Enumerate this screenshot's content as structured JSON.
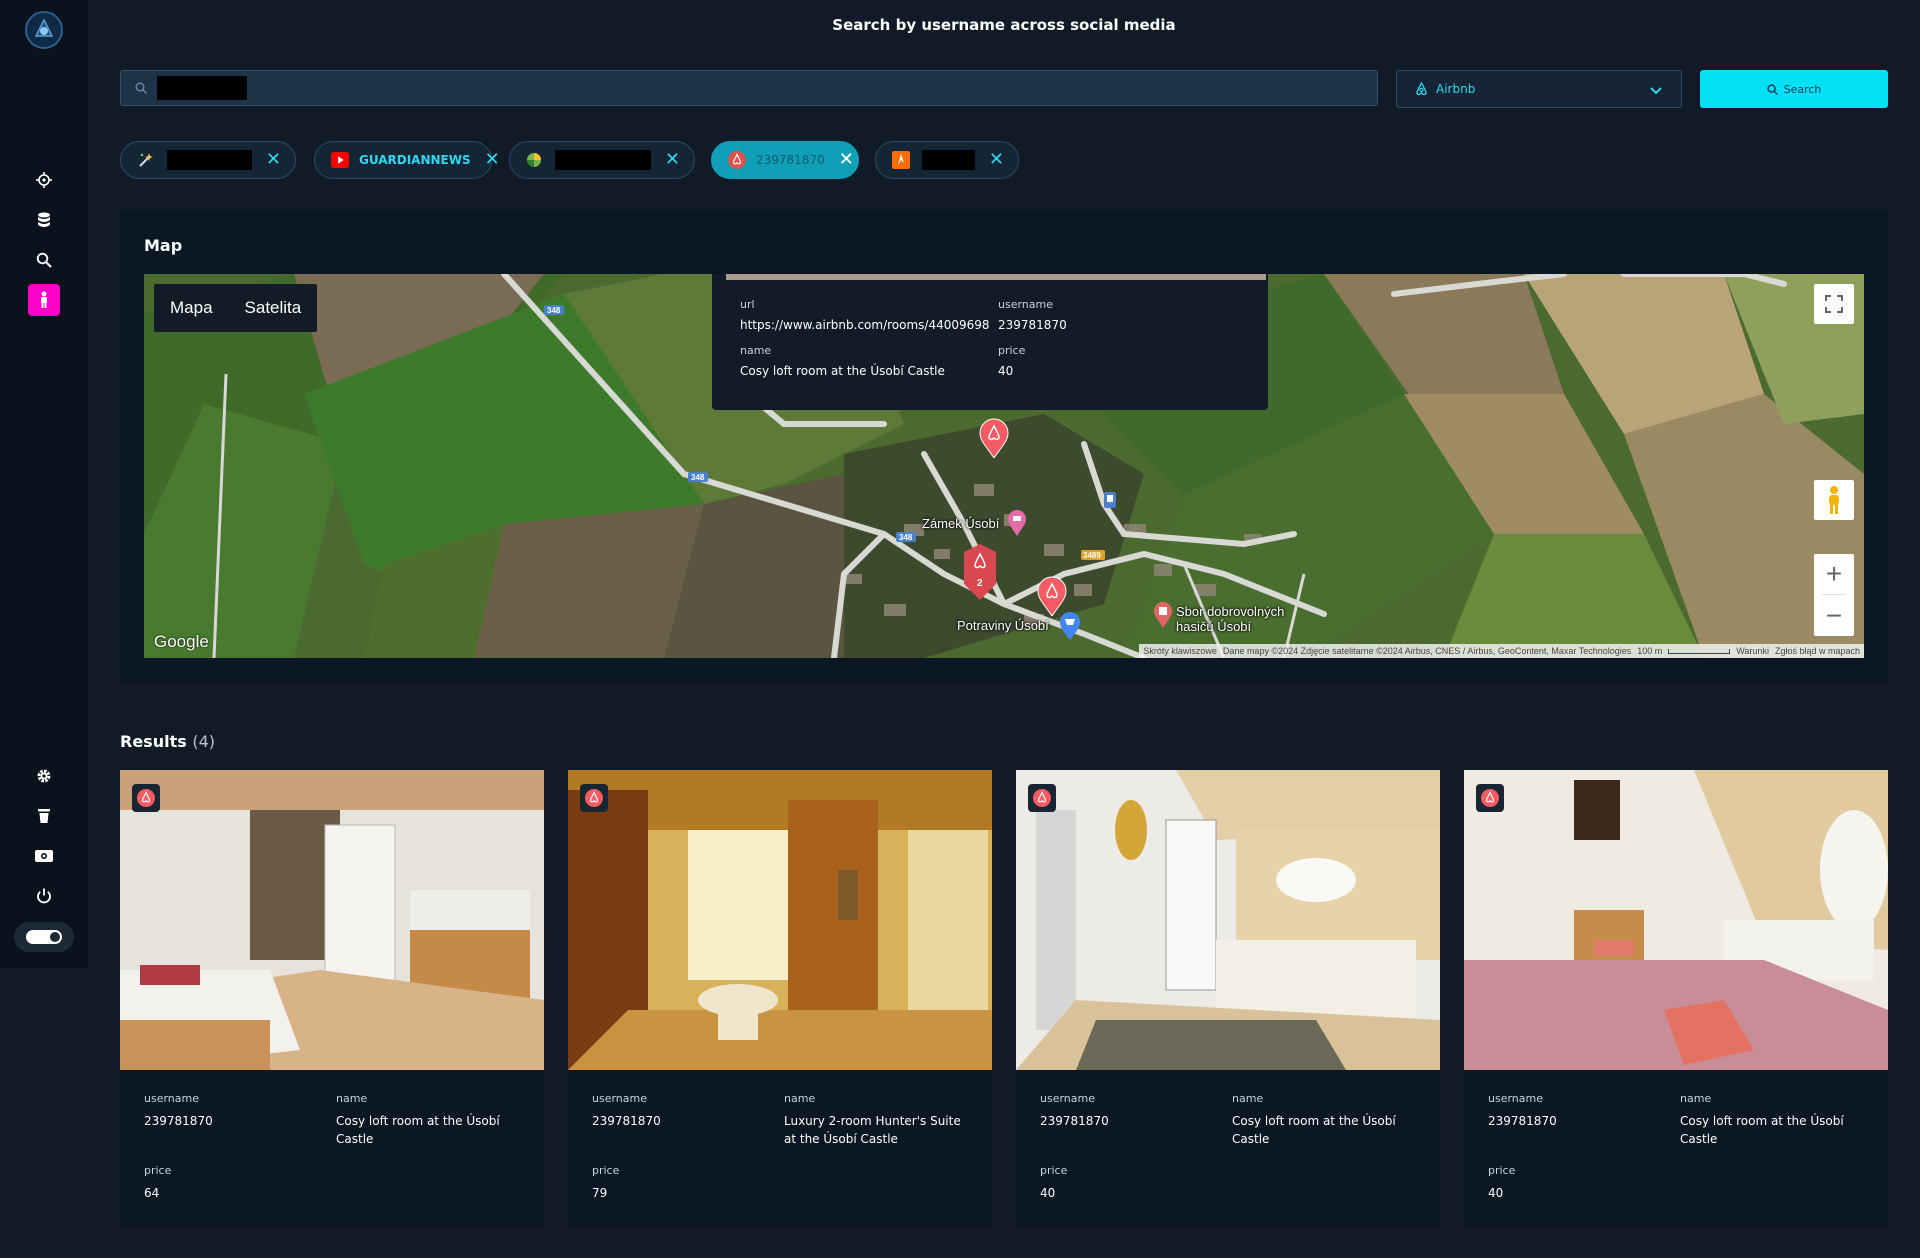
{
  "header": {
    "title": "Search by username across social media",
    "search_placeholder": "",
    "search_value": "",
    "platform_selected": "Airbnb",
    "search_button_label": "Search"
  },
  "chips": [
    {
      "platform": "unknown-wand",
      "label": "",
      "redacted": true
    },
    {
      "platform": "youtube",
      "label": "GUARDIANNEWS",
      "redacted": false
    },
    {
      "platform": "colorful-leaf",
      "label": "",
      "redacted": true
    },
    {
      "platform": "airbnb",
      "label": "239781870",
      "redacted": false,
      "active": true
    },
    {
      "platform": "orange-flame",
      "label": "",
      "redacted": true
    }
  ],
  "map": {
    "title": "Map",
    "type_options": [
      "Mapa",
      "Satelita"
    ],
    "popup": {
      "url_label": "url",
      "url_value": "https://www.airbnb.com/rooms/44009698",
      "username_label": "username",
      "username_value": "239781870",
      "name_label": "name",
      "name_value": "Cosy loft room at the Úsobí Castle",
      "price_label": "price",
      "price_value": "40"
    },
    "labels": {
      "castle": "Zámek Úsobí",
      "shop": "Potraviny Úsobí",
      "firestation_line1": "Sbor dobrovolných",
      "firestation_line2": "hasičů Úsobí"
    },
    "road_labels": [
      "348",
      "348",
      "348",
      "3489"
    ],
    "cluster_count": "2",
    "google_logo": "Google",
    "attribution": {
      "shortcuts": "Skróty klawiszowe",
      "data": "Dane mapy ©2024 Zdjęcie satelitarne ©2024 Airbus, CNES / Airbus, GeoContent, Maxar Technologies",
      "scale": "100 m",
      "terms": "Warunki",
      "report": "Zgłoś błąd w mapach"
    }
  },
  "results": {
    "title": "Results",
    "count_label": "(4)",
    "labels": {
      "username": "username",
      "name": "name",
      "price": "price"
    },
    "items": [
      {
        "username": "239781870",
        "name": "Cosy loft room at the Úsobí Castle",
        "price": "64"
      },
      {
        "username": "239781870",
        "name": "Luxury 2-room Hunter's Suite at the Úsobí Castle",
        "price": "79"
      },
      {
        "username": "239781870",
        "name": "Cosy loft room at the Úsobí Castle",
        "price": "40"
      },
      {
        "username": "239781870",
        "name": "Cosy loft room at the Úsobí Castle",
        "price": "40"
      }
    ]
  },
  "sidebar": {
    "top_icons": [
      "crosshair-icon",
      "database-icon",
      "search-icon",
      "person-icon"
    ],
    "bottom_icons": [
      "gear-icon",
      "trash-icon",
      "money-icon",
      "power-icon"
    ],
    "active_item": "person-icon"
  },
  "colors": {
    "accent": "#00e1f5",
    "active_sidebar": "#ff00c8",
    "airbnb": "#ff5a5f",
    "background": "#101b27"
  }
}
